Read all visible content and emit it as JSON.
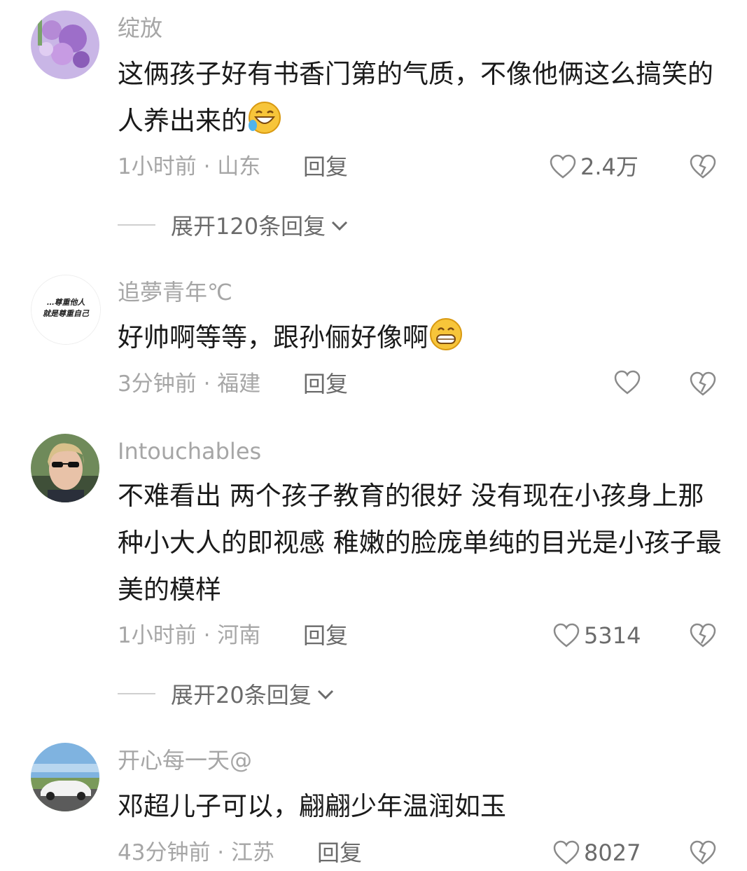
{
  "comments": [
    {
      "username": "绽放",
      "text": "这俩孩子好有书香门第的气质，不像他俩这么搞笑的人养出来的",
      "emoji": "laughing-tears-emoji",
      "meta": "1小时前 · 山东",
      "reply": "回复",
      "likes": "2.4万",
      "expand": "展开120条回复"
    },
    {
      "username": "追夢青年℃",
      "text": "好帅啊等等，跟孙俪好像啊",
      "emoji": "grinning-emoji",
      "meta": "3分钟前 · 福建",
      "reply": "回复",
      "likes": ""
    },
    {
      "username": "Intouchables",
      "text": "不难看出 两个孩子教育的很好 没有现在小孩身上那种小大人的即视感 稚嫩的脸庞单纯的目光是小孩子最美的模样",
      "meta": "1小时前 · 河南",
      "reply": "回复",
      "likes": "5314",
      "expand": "展开20条回复"
    },
    {
      "username": "开心每一天@",
      "text": "邓超儿子可以，翩翩少年温润如玉",
      "meta": "43分钟前 · 江苏",
      "reply": "回复",
      "likes": "8027"
    }
  ],
  "avatar2_text": [
    "…尊重他人",
    "就是尊重自己"
  ],
  "colors": {
    "username": "#a6a6a6",
    "text": "#1a1a1a",
    "meta": "#a6a6a6",
    "action": "#6b6b6b",
    "divider": "#cfcfcf"
  }
}
